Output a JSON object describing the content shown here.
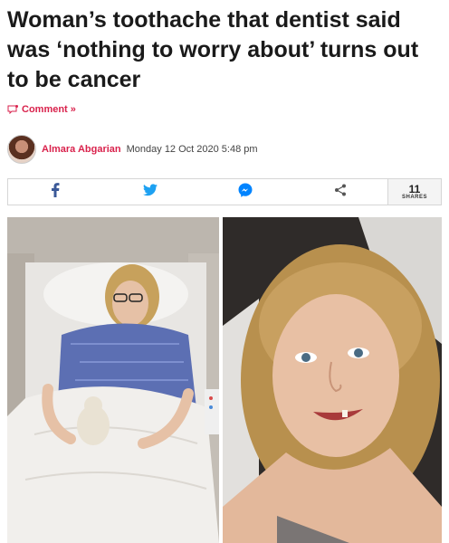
{
  "headline": "Woman’s toothache that dentist said was ‘nothing to worry about’ turns out to be cancer",
  "comment_link": "Comment »",
  "byline": {
    "author": "Almara Abgarian",
    "date": "Monday 12 Oct 2020 5:48 pm"
  },
  "share_bar": {
    "buttons": [
      "facebook-icon",
      "twitter-icon",
      "messenger-icon",
      "share-icon"
    ],
    "count": "11",
    "count_label": "SHARES"
  },
  "colors": {
    "accent": "#d9224c",
    "facebook": "#3b5998",
    "twitter": "#1da1f2",
    "messenger": "#0084ff",
    "share": "#555555"
  },
  "images": [
    {
      "description_icon": "hospital-bed-photo"
    },
    {
      "description_icon": "selfie-photo"
    }
  ]
}
